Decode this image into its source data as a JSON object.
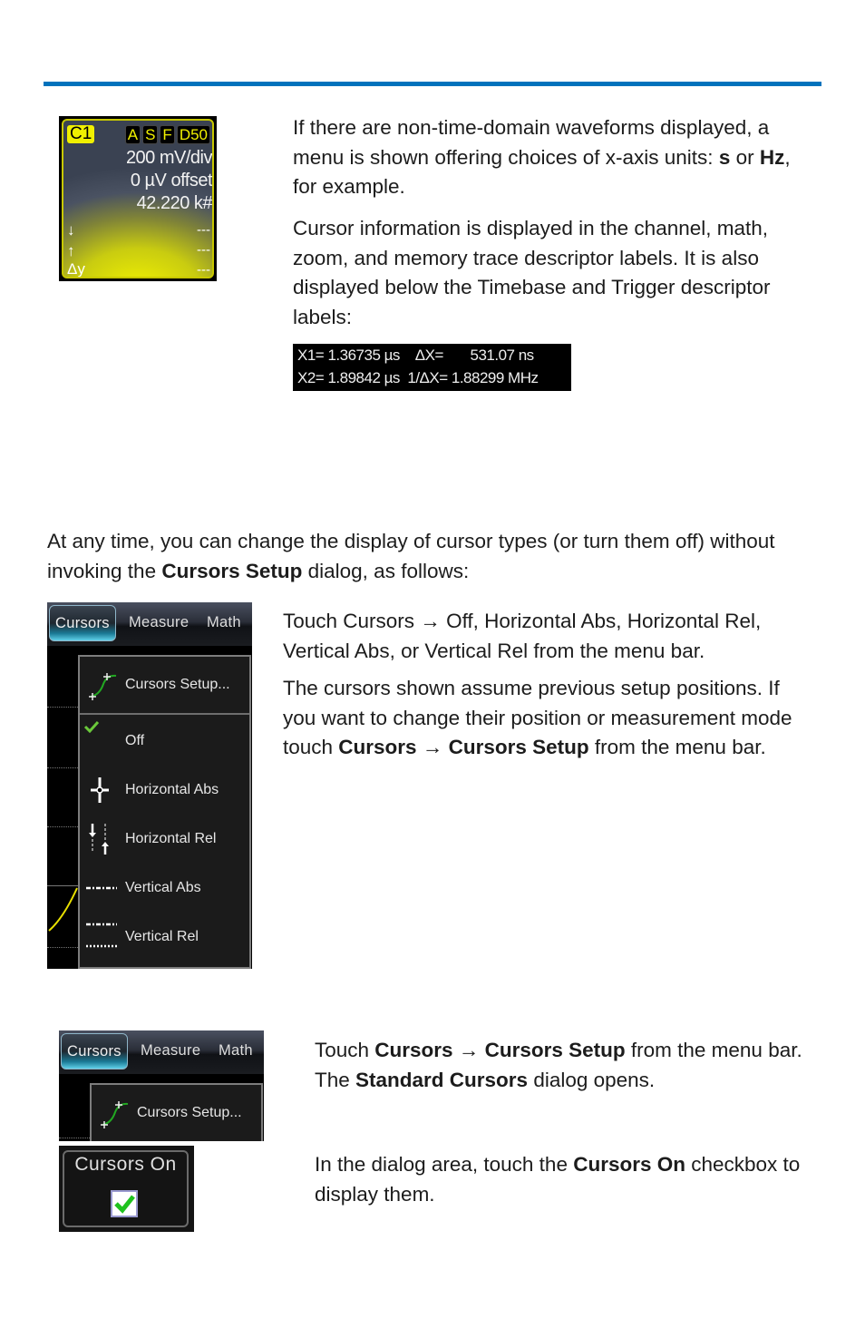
{
  "colors": {
    "rule": "#0072bc",
    "channel_yellow": "#f0f000",
    "check_green": "#22cc22"
  },
  "channel_descriptor": {
    "tag": "C1",
    "flags": [
      "A",
      "S",
      "F",
      "D50"
    ],
    "lines": [
      "200 mV/div",
      "0 µV offset",
      "42.220 k#"
    ],
    "cursor_rows": [
      {
        "icon": "↓",
        "value": "---"
      },
      {
        "icon": "↑",
        "value": "---"
      },
      {
        "icon": "Δy",
        "value": "---"
      }
    ]
  },
  "paragraphs": {
    "p1": {
      "t1": "If there are non-time-domain waveforms displayed, a menu is shown offering choices of x-axis units: ",
      "b1": "s",
      "t2": " or ",
      "b2": "Hz",
      "t3": ", for example."
    },
    "p2": "Cursor information is displayed in the channel, math, zoom, and memory trace descriptor labels. It is also displayed below the Timebase and Trigger descriptor labels:",
    "p3": {
      "t1": "At any time, you can change the display of cursor types (or turn them off) without invoking the ",
      "b1": "Cursors Setup",
      "t2": " dialog, as follows:"
    },
    "p4": {
      "t1": "Touch Cursors ",
      "arrow": "→",
      "t2": " Off, Horizontal Abs, Horizontal Rel, Vertical Abs, or Vertical Rel from the menu bar."
    },
    "p5": {
      "t1": "The cursors shown assume previous setup positions. If you want to change their position or measurement mode touch ",
      "b1": "Cursors",
      "arrow": " → ",
      "b2": "Cursors Setup",
      "t2": " from the menu bar."
    },
    "p6": {
      "t1": "Touch ",
      "b1": "Cursors",
      "arrow": " → ",
      "b2": "Cursors Setup",
      "t2": " from the menu bar. The ",
      "b3": "Standard Cursors",
      "t3": " dialog opens."
    },
    "p7": {
      "t1": "In the dialog area, touch the ",
      "b1": "Cursors On",
      "t2": " checkbox to display them."
    }
  },
  "readout": {
    "row1": "X1= 1.36735 µs    ΔX=       531.07 ns",
    "row2": "X2= 1.89842 µs  1/ΔX= 1.88299 MHz"
  },
  "menu1": {
    "menubar": [
      "Cursors",
      "Measure",
      "Math"
    ],
    "items": [
      {
        "label": "Cursors Setup...",
        "icon": "cursors-setup-icon"
      },
      {
        "label": "Off",
        "icon": "checkmark-icon",
        "checked": true
      },
      {
        "label": "Horizontal Abs",
        "icon": "horizontal-abs-icon"
      },
      {
        "label": "Horizontal Rel",
        "icon": "horizontal-rel-icon"
      },
      {
        "label": "Vertical Abs",
        "icon": "vertical-abs-icon"
      },
      {
        "label": "Vertical Rel",
        "icon": "vertical-rel-icon"
      }
    ]
  },
  "menu2": {
    "menubar": [
      "Cursors",
      "Measure",
      "Math"
    ],
    "items": [
      {
        "label": "Cursors Setup...",
        "icon": "cursors-setup-icon"
      }
    ]
  },
  "checkbox": {
    "label": "Cursors On",
    "checked": true
  }
}
